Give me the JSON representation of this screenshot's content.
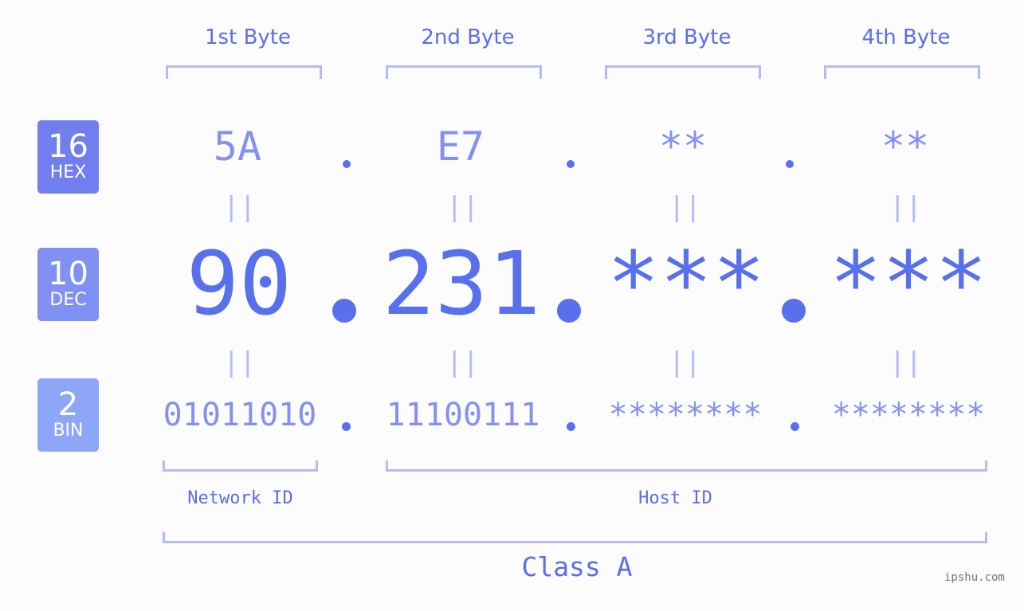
{
  "colors": {
    "hex_badge": "#717fee",
    "dec_badge": "#8191f3",
    "bin_badge": "#8ea6f8",
    "accent": "#5870ec",
    "light_text": "#8491ee",
    "bracket": "#b3bcf7",
    "watermark": "#777777"
  },
  "badges": {
    "hex": {
      "number": "16",
      "label": "HEX"
    },
    "dec": {
      "number": "10",
      "label": "DEC"
    },
    "bin": {
      "number": "2",
      "label": "BIN"
    }
  },
  "bytes": [
    {
      "header": "1st Byte",
      "hex": "5A",
      "dec": "90",
      "bin": "01011010"
    },
    {
      "header": "2nd Byte",
      "hex": "E7",
      "dec": "231",
      "bin": "11100111"
    },
    {
      "header": "3rd Byte",
      "hex": "**",
      "dec": "***",
      "bin": "********"
    },
    {
      "header": "4th Byte",
      "hex": "**",
      "dec": "***",
      "bin": "********"
    }
  ],
  "equals_symbol": "||",
  "segments": {
    "network": "Network ID",
    "host": "Host ID",
    "class": "Class A"
  },
  "watermark": "ipshu.com"
}
